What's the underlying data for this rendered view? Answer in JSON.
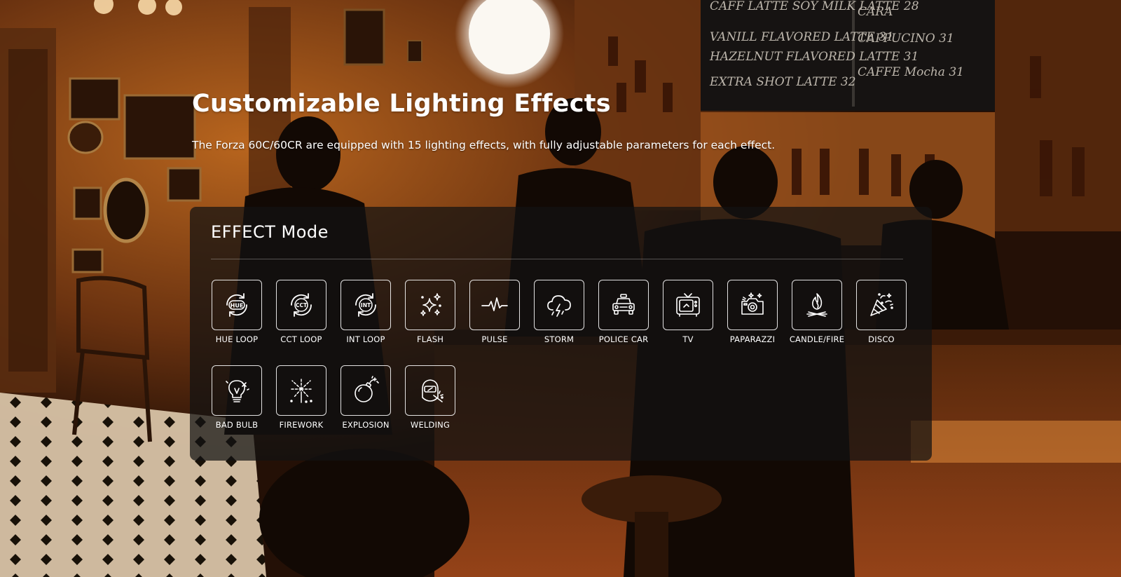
{
  "hero": {
    "title": "Customizable Lighting Effects",
    "subtitle": "The Forza 60C/60CR are equipped with 15 lighting effects, with fully adjustable parameters for each effect."
  },
  "panel": {
    "title": "EFFECT Mode"
  },
  "effects": [
    {
      "label": "HUE LOOP",
      "icon": "hue-loop-icon",
      "badge": "HUE"
    },
    {
      "label": "CCT LOOP",
      "icon": "cct-loop-icon",
      "badge": "CCT"
    },
    {
      "label": "INT LOOP",
      "icon": "int-loop-icon",
      "badge": "INT"
    },
    {
      "label": "FLASH",
      "icon": "flash-icon"
    },
    {
      "label": "PULSE",
      "icon": "pulse-icon"
    },
    {
      "label": "STORM",
      "icon": "storm-icon"
    },
    {
      "label": "POLICE CAR",
      "icon": "police-car-icon"
    },
    {
      "label": "TV",
      "icon": "tv-icon"
    },
    {
      "label": "PAPARAZZI",
      "icon": "paparazzi-icon"
    },
    {
      "label": "CANDLE/FIRE",
      "icon": "candle-fire-icon"
    },
    {
      "label": "DISCO",
      "icon": "disco-icon"
    },
    {
      "label": "BAD BULB",
      "icon": "bad-bulb-icon"
    },
    {
      "label": "FIREWORK",
      "icon": "firework-icon"
    },
    {
      "label": "EXPLOSION",
      "icon": "explosion-icon"
    },
    {
      "label": "WELDING",
      "icon": "welding-icon"
    }
  ],
  "background": {
    "menu_board": [
      "CAFF LATTE SOY MILK LATTE 28",
      "VANILL FLAVORED LATTE 31",
      "HAZELNUT FLAVORED LATTE 31",
      "EXTRA SHOT LATTE 32",
      "CARA",
      "CAPPUCINO 31",
      "CAFFE Mocha 31"
    ]
  },
  "colors": {
    "panel_bg": "#121212",
    "text": "#ffffff",
    "ambient_orange": "#c2631c"
  }
}
